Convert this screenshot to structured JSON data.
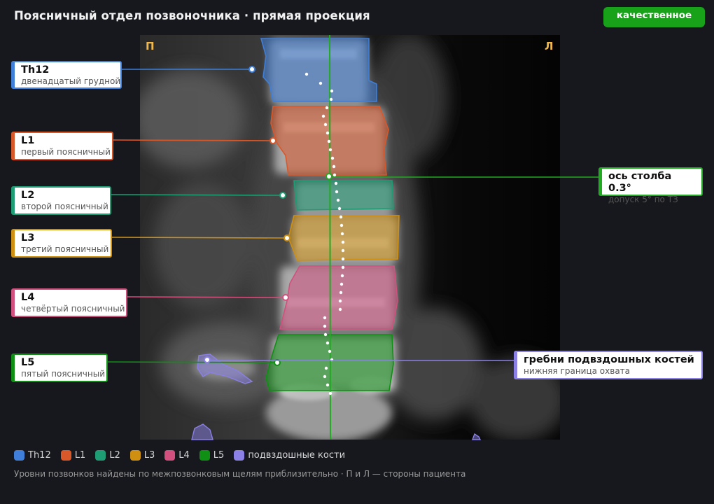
{
  "header": {
    "title": "Поясничный отдел позвоночника · прямая проекция",
    "badge": "качественное"
  },
  "viewer": {
    "side_right_patient": "П",
    "side_left_patient": "Л"
  },
  "colors": {
    "Th12": "#3f7fd9",
    "L1": "#d9582a",
    "L2": "#1e9c74",
    "L3": "#cf8f10",
    "L4": "#d2507e",
    "L5": "#0f8f14",
    "ilium": "#8a80e6",
    "axis": "#22aa22"
  },
  "vertebrae": [
    {
      "id": "Th12",
      "name": "Th12",
      "desc": "двенадцатый грудной"
    },
    {
      "id": "L1",
      "name": "L1",
      "desc": "первый поясничный"
    },
    {
      "id": "L2",
      "name": "L2",
      "desc": "второй поясничный"
    },
    {
      "id": "L3",
      "name": "L3",
      "desc": "третий поясничный"
    },
    {
      "id": "L4",
      "name": "L4",
      "desc": "четвёртый поясничный"
    },
    {
      "id": "L5",
      "name": "L5",
      "desc": "пятый поясничный"
    }
  ],
  "axis_callout": {
    "title": "ось столба 0.3°",
    "sub": "допуск 5° по ТЗ"
  },
  "ilium_callout": {
    "title": "гребни подвздошных костей",
    "sub": "нижняя граница охвата"
  },
  "legend": [
    {
      "label": "Th12",
      "color": "#3f7fd9"
    },
    {
      "label": "L1",
      "color": "#d9582a"
    },
    {
      "label": "L2",
      "color": "#1e9c74"
    },
    {
      "label": "L3",
      "color": "#cf8f10"
    },
    {
      "label": "L4",
      "color": "#d2507e"
    },
    {
      "label": "L5",
      "color": "#0f8f14"
    },
    {
      "label": "подвздошные кости",
      "color": "#8a80e6"
    }
  ],
  "footnote": "Уровни позвонков найдены по межпозвонковым щелям приблизительно · П и Л — стороны пациента"
}
